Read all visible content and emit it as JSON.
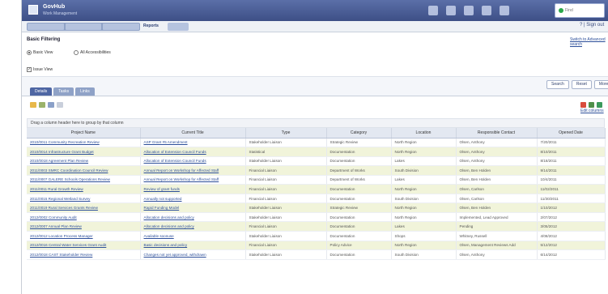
{
  "header": {
    "app_name": "GovHub",
    "app_subtitle": "Work Management",
    "search_placeholder": "Find"
  },
  "tabs": {
    "active_label": "Reports",
    "help": "? | Sign out"
  },
  "filters": {
    "heading": "Basic Filtering",
    "advanced_link": "Switch to Advanced search",
    "radio_options": [
      "Basic View",
      "All Accessibilities"
    ],
    "checkbox_label": "Issue View"
  },
  "subtabs": [
    "Details",
    "Tasks",
    "Links"
  ],
  "actions": [
    "Search",
    "Reset",
    "More"
  ],
  "grid": {
    "export_link": "Edit columns",
    "group_hint": "Drag a column header here to group by that column",
    "columns": [
      "Project Name",
      "Current Title",
      "Type",
      "Category",
      "Location",
      "Responsible Contact",
      "Opened Date"
    ],
    "rows": [
      [
        "2010/0011 Community Recreation Review",
        "ASP Grant #5 Amendment",
        "Stakeholder Liaison",
        "Strategic Review",
        "North Region",
        "Olsen, Anthony",
        "7/20/2011"
      ],
      [
        "2010/0014 Infrastructure Grant Budget",
        "Allocation of Extension Council Funds",
        "Statistical",
        "Documentation",
        "North Region",
        "Olsen, Anthony",
        "8/10/2011"
      ],
      [
        "2010/0018 Agreement Plan Review",
        "Allocation of Extension Council Funds",
        "Stakeholder Liaison",
        "Documentation",
        "Lakes",
        "Olsen, Anthony",
        "8/18/2011"
      ],
      [
        "2011/0003 SMRC Coordination Council Review",
        "Annual Report on Workshop for Affected Staff",
        "Financial Liaison",
        "Department of Works",
        "South Division",
        "Olsen, Ben Holden",
        "9/14/2011"
      ],
      [
        "2011/0007 GALERE Schools Operations Review",
        "Annual Report on Workshop for Affected Staff",
        "Financial Liaison",
        "Department of Works",
        "Lakes",
        "Olsen, Ben Holden",
        "10/4/2011"
      ],
      [
        "2011/0011 Rural Growth Review",
        "Review of grant funds",
        "Financial Liaison",
        "Documentation",
        "North Region",
        "Olsen, Carlson",
        "11/02/2011"
      ],
      [
        "2011/0015 Regional Wetland Survey",
        "Annually not supported",
        "Financial Liaison",
        "Documentation",
        "South Division",
        "Olsen, Carlson",
        "11/30/2011"
      ],
      [
        "2011/0019 Rural Services Grants Review",
        "Rapid Funding Model",
        "Stakeholder Liaison",
        "Strategic Review",
        "North Region",
        "Olsen, Ben Holden",
        "1/10/2012"
      ],
      [
        "2012/0002 Community Audit",
        "Allocation decisions and policy",
        "Stakeholder Liaison",
        "Documentation",
        "North Region",
        "Implemented, Lead Approved",
        "2/07/2012"
      ],
      [
        "2012/0007 Annual Plan Review",
        "Allocation decisions and policy",
        "Financial Liaison",
        "Documentation",
        "Lakes",
        "Pending",
        "3/05/2012"
      ],
      [
        "2012/0012 Location Process Manager",
        "Available soonuse",
        "Stakeholder Liaison",
        "Documentation",
        "Shops",
        "Whitney, Russell",
        "4/08/2012"
      ],
      [
        "2012/0016 Central Water Services Grant Audit",
        "Basic decisions and policy",
        "Financial Liaison",
        "Policy Advice",
        "North Region",
        "Olsen, Management Reviews Add",
        "5/12/2012"
      ],
      [
        "2012/0018 CAST Stakeholder Review",
        "Changes not yet approved, withdrawn",
        "Stakeholder Liaison",
        "Documentation",
        "South Division",
        "Olsen, Anthony",
        "6/14/2012"
      ]
    ]
  },
  "colors": {
    "header_top": "#5b6fa8",
    "header_bottom": "#3d4f86",
    "row_alt": "#f1f4da",
    "link": "#2d4f9a"
  }
}
